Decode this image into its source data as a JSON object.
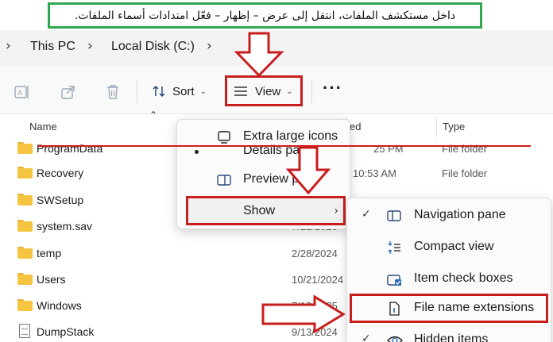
{
  "banner": {
    "text": "داخل مستكشف الملفات، انتقل إلى عرض – إظهار – فعّل امتدادات أسماء الملفات."
  },
  "address": {
    "crumbs": [
      "This PC",
      "Local Disk (C:)"
    ]
  },
  "toolbar": {
    "sort_label": "Sort",
    "view_label": "View",
    "icons": [
      "rename-icon",
      "share-icon",
      "delete-icon",
      "sort-icon",
      "view-icon",
      "more-icon"
    ]
  },
  "columns": {
    "name": "Name",
    "date": "ed",
    "type": "Type"
  },
  "files": [
    {
      "name": "ProgramData",
      "date": "",
      "type": "File folder",
      "kind": "folder"
    },
    {
      "name": "Recovery",
      "date": "10:53 AM",
      "type": "File folder",
      "kind": "folder"
    },
    {
      "name": "SWSetup",
      "date": "",
      "type": "",
      "kind": "folder"
    },
    {
      "name": "system.sav",
      "date": "7/22/2023",
      "type": "",
      "kind": "folder"
    },
    {
      "name": "temp",
      "date": "2/28/2024",
      "type": "",
      "kind": "folder"
    },
    {
      "name": "Users",
      "date": "10/21/2024",
      "type": "",
      "kind": "folder"
    },
    {
      "name": "Windows",
      "date": "7/12/2025",
      "type": "",
      "kind": "folder"
    },
    {
      "name": "DumpStack",
      "date": "9/13/2024",
      "type": "",
      "kind": "file"
    }
  ],
  "view_menu": {
    "items": [
      {
        "label": "Extra large icons"
      },
      {
        "label": "Details pane"
      },
      {
        "label": "Preview pane"
      },
      {
        "label": "Show"
      }
    ]
  },
  "show_menu": {
    "items": [
      {
        "label": "Navigation pane",
        "checked": true
      },
      {
        "label": "Compact view",
        "checked": false
      },
      {
        "label": "Item check boxes",
        "checked": false
      },
      {
        "label": "File name extensions",
        "checked": false
      },
      {
        "label": "Hidden items",
        "checked": true
      }
    ]
  },
  "colors": {
    "highlight": "#c81e1e",
    "banner_border": "#2fa84f",
    "folder": "#f5c542"
  }
}
